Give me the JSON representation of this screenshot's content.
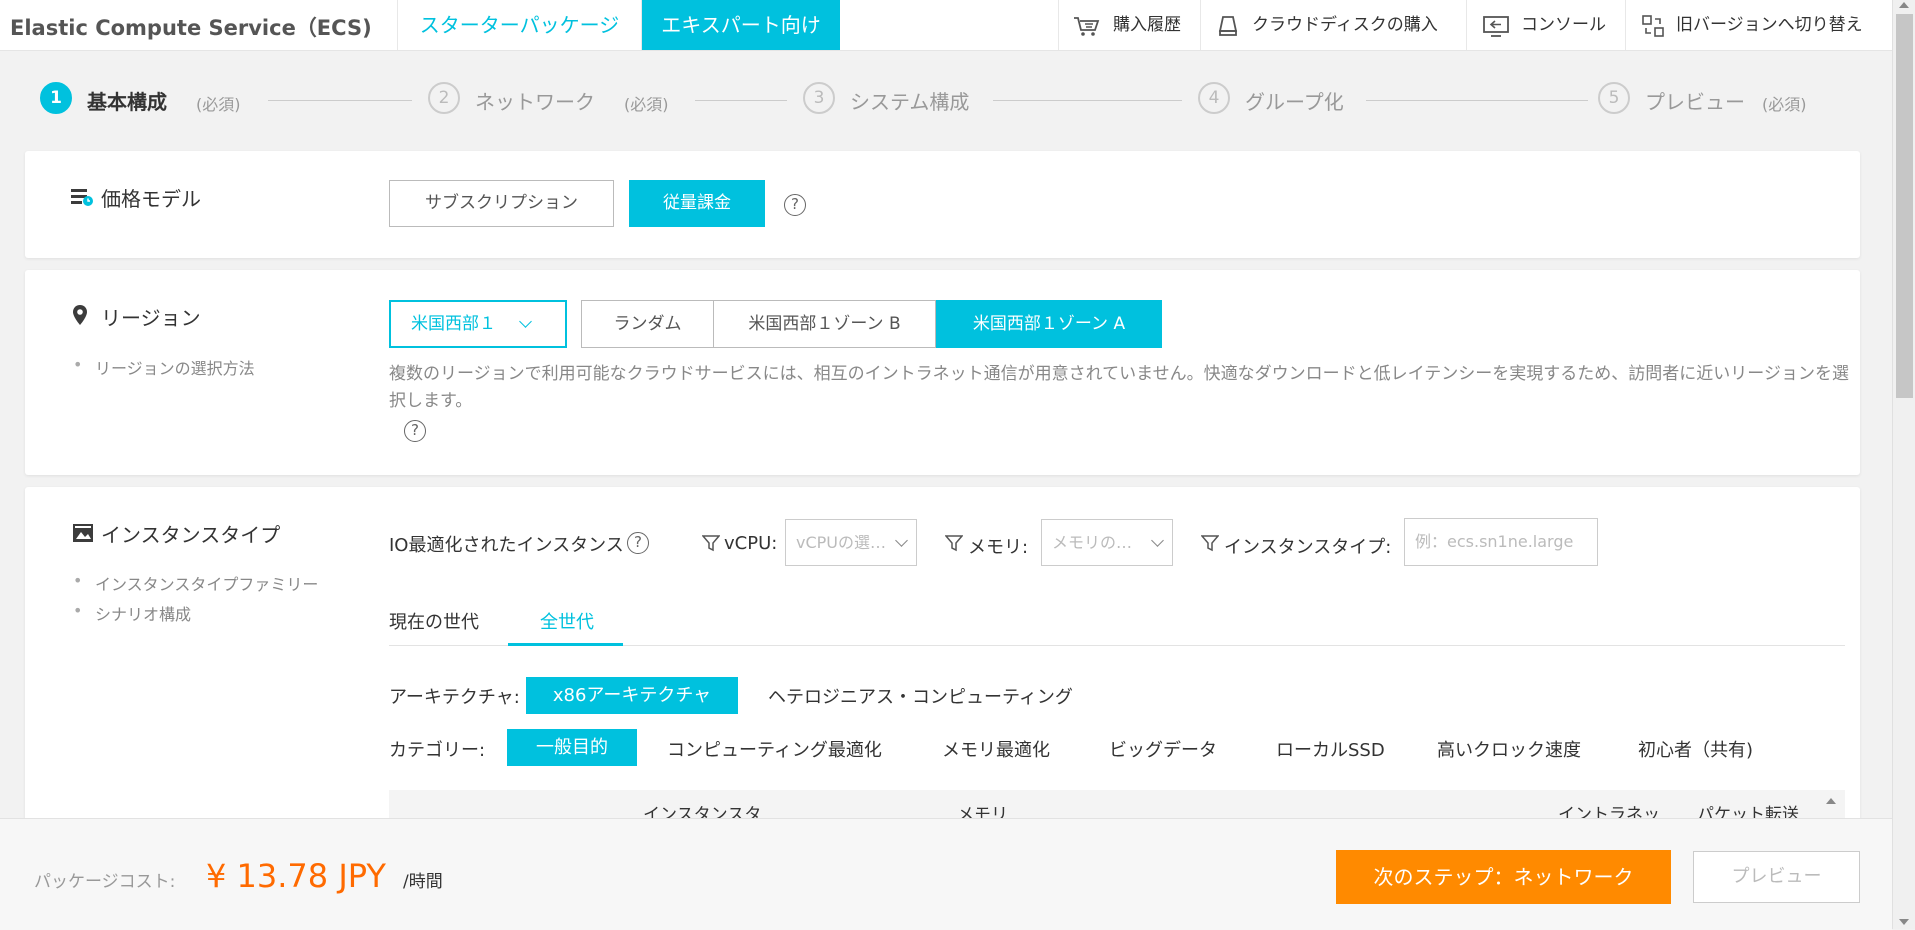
{
  "header": {
    "app_title": "Elastic Compute Service（ECS)",
    "tabs": [
      {
        "label": "スターターパッケージ",
        "active": false
      },
      {
        "label": "エキスパート向け",
        "active": true
      }
    ],
    "links": [
      {
        "label": "購入履歴",
        "icon": "cart-icon"
      },
      {
        "label": "クラウドディスクの購入",
        "icon": "disk-icon"
      },
      {
        "label": "コンソール",
        "icon": "console-icon"
      },
      {
        "label": "旧バージョンへ切り替え",
        "icon": "switch-icon"
      }
    ]
  },
  "stepper": {
    "steps": [
      {
        "number": "1",
        "label": "基本構成",
        "note": "(必須)",
        "active": true
      },
      {
        "number": "2",
        "label": "ネットワーク",
        "note": "(必須)",
        "active": false
      },
      {
        "number": "3",
        "label": "システム構成",
        "note": "",
        "active": false
      },
      {
        "number": "4",
        "label": "グループ化",
        "note": "",
        "active": false
      },
      {
        "number": "5",
        "label": "プレビュー",
        "note": "(必須)",
        "active": false
      }
    ]
  },
  "billing": {
    "title": "価格モデル",
    "options": [
      {
        "label": "サブスクリプション",
        "selected": false
      },
      {
        "label": "従量課金",
        "selected": true
      }
    ],
    "help": "?"
  },
  "region": {
    "title": "リージョン",
    "bullets": [
      "リージョンの選択方法"
    ],
    "region_select": "米国西部１",
    "zones": [
      {
        "label": "ランダム",
        "selected": false
      },
      {
        "label": "米国西部１ゾーン B",
        "selected": false
      },
      {
        "label": "米国西部１ゾーン A",
        "selected": true
      }
    ],
    "description": "複数のリージョンで利用可能なクラウドサービスには、相互のイントラネット通信が用意されていません。快適なダウンロードと低レイテンシーを実現するため、訪問者に近いリージョンを選択します。",
    "help": "?"
  },
  "instance": {
    "title": "インスタンスタイプ",
    "bullets": [
      "インスタンスタイプファミリー",
      "シナリオ構成"
    ],
    "io_label": "IO最適化されたインスタンス",
    "help": "?",
    "filters": {
      "vcpu_label": "vCPU:",
      "vcpu_placeholder": "vCPUの選…",
      "memory_label": "メモリ:",
      "memory_placeholder": "メモリの…",
      "type_label": "インスタンスタイプ:",
      "type_placeholder": "例：ecs.sn1ne.large"
    },
    "generation_tabs": [
      {
        "label": "現在の世代",
        "active": false
      },
      {
        "label": "全世代",
        "active": true
      }
    ],
    "architecture_label": "アーキテクチャ:",
    "architectures": [
      {
        "label": "x86アーキテクチャ",
        "selected": true
      },
      {
        "label": "ヘテロジニアス・コンピューティング",
        "selected": false
      }
    ],
    "category_label": "カテゴリー:",
    "categories": [
      {
        "label": "一般目的",
        "selected": true
      },
      {
        "label": "コンピューティング最適化",
        "selected": false
      },
      {
        "label": "メモリ最適化",
        "selected": false
      },
      {
        "label": "ビッグデータ",
        "selected": false
      },
      {
        "label": "ローカルSSD",
        "selected": false
      },
      {
        "label": "高いクロック速度",
        "selected": false
      },
      {
        "label": "初心者（共有)",
        "selected": false
      }
    ],
    "table_headers": [
      "インスタンスタ",
      "メモリ",
      "イントラネッ",
      "パケット転送"
    ]
  },
  "footer": {
    "cost_label": "パッケージコスト:",
    "price": "¥ 13.78 JPY",
    "unit": "/時間",
    "next_button": "次のステップ：ネットワーク",
    "preview_button": "プレビュー"
  },
  "colors": {
    "accent": "#00c1de",
    "price": "#ff6a00",
    "next_button": "#ff8a00"
  }
}
